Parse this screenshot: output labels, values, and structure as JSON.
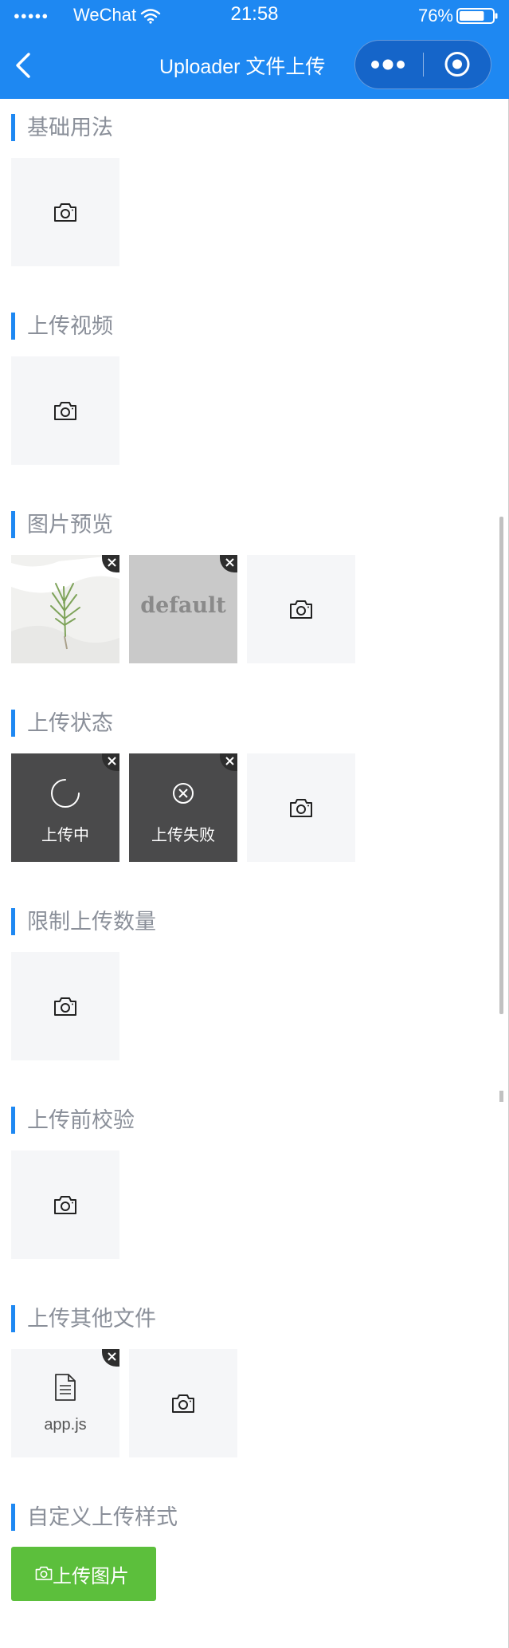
{
  "status_bar": {
    "signal": "●●●●●",
    "carrier": "WeChat",
    "time": "21:58",
    "battery": "76%",
    "battery_level": 0.76
  },
  "nav": {
    "title": "Uploader 文件上传",
    "back_icon": "chevron-left-icon",
    "more_icon": "more-dots-icon",
    "close_icon": "target-circle-icon"
  },
  "colors": {
    "primary": "#1e88f2",
    "tile_bg": "#f5f6f8",
    "title_text": "#8a8f99",
    "custom_button": "#5cbf3c"
  },
  "sections": [
    {
      "title": "基础用法"
    },
    {
      "title": "上传视频"
    },
    {
      "title": "图片预览",
      "items": [
        {
          "type": "image",
          "icon": "plant-image"
        },
        {
          "type": "image",
          "text": "default"
        }
      ]
    },
    {
      "title": "上传状态",
      "items": [
        {
          "status": "loading",
          "label": "上传中",
          "icon": "spinner-icon"
        },
        {
          "status": "failed",
          "label": "上传失败",
          "icon": "close-circle-icon"
        }
      ]
    },
    {
      "title": "限制上传数量"
    },
    {
      "title": "上传前校验"
    },
    {
      "title": "上传其他文件",
      "items": [
        {
          "type": "file",
          "name": "app.js",
          "icon": "file-icon"
        }
      ]
    },
    {
      "title": "自定义上传样式",
      "button_label": "上传图片",
      "button_icon": "camera-icon"
    }
  ]
}
